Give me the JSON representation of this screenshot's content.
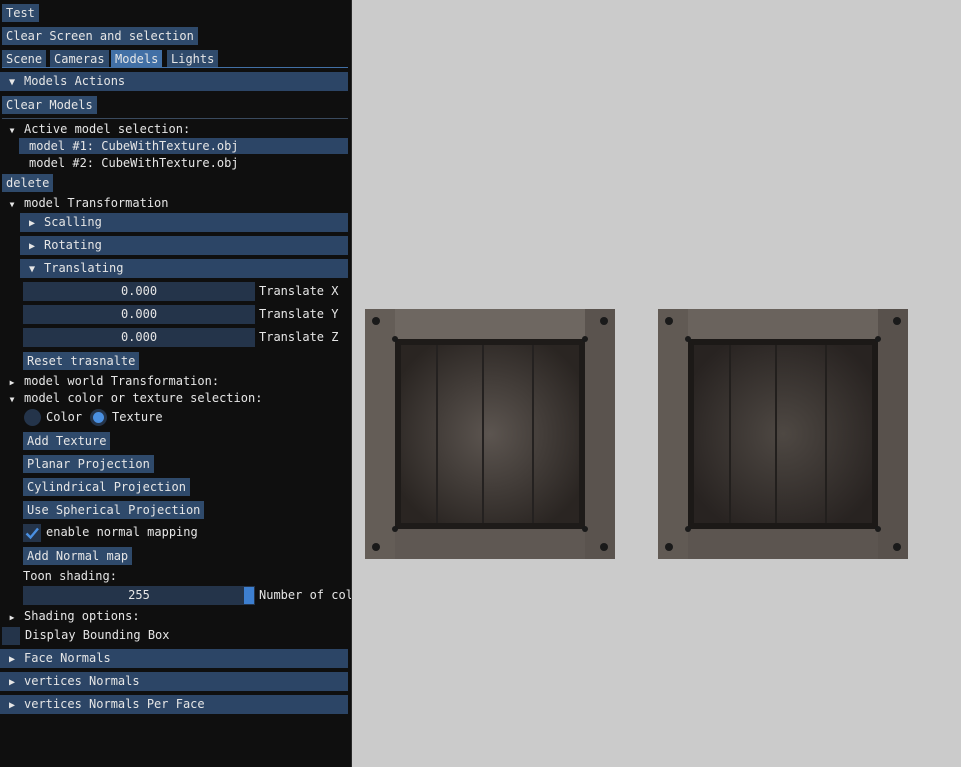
{
  "panel": {
    "test_label": "Test",
    "clear_screen_label": "Clear Screen and selection",
    "tabs": [
      {
        "label": "Scene"
      },
      {
        "label": "Cameras"
      },
      {
        "label": "Models"
      },
      {
        "label": "Lights"
      }
    ],
    "models_actions": "Models Actions",
    "clear_models": "Clear Models",
    "active_selection": "Active model selection:",
    "models": [
      "model #1: CubeWithTexture.obj",
      "model #2: CubeWithTexture.obj"
    ],
    "delete_label": "delete",
    "model_transformation": "model Transformation",
    "scalling": "Scalling",
    "rotating": "Rotating",
    "translating": "Translating",
    "translate": [
      {
        "value": "0.000",
        "label": "Translate X"
      },
      {
        "value": "0.000",
        "label": "Translate Y"
      },
      {
        "value": "0.000",
        "label": "Translate Z"
      }
    ],
    "reset_translate": "Reset trasnalte",
    "world_transformation": "model world Transformation:",
    "color_texture_selection": "model color or texture selection:",
    "color_label": "Color",
    "texture_label": "Texture",
    "selected_mode": "Texture",
    "add_texture": "Add Texture",
    "planar_projection": "Planar Projection",
    "cylindrical_projection": "Cylindrical Projection",
    "spherical_projection": "Use Spherical Projection",
    "normal_mapping_label": "enable normal mapping",
    "normal_mapping_checked": true,
    "add_normal_map": "Add Normal map",
    "toon_shading": "Toon shading:",
    "toon_value": "255",
    "toon_fill": 1.0,
    "num_colors_label": "Number of col",
    "shading_options": "Shading options:",
    "bounding_box_label": "Display Bounding Box",
    "bounding_box_checked": false,
    "face_normals": "Face Normals",
    "vertices_normals": "vertices Normals",
    "vertices_normals_per_face": "vertices Normals Per Face"
  },
  "icons": {
    "expanded": "triangle-down-icon",
    "collapsed": "triangle-right-icon",
    "check": "checkmark-icon"
  },
  "colors": {
    "button": "#2f4a6b",
    "active": "#4270a6",
    "accent": "#4a90e2",
    "panel_bg": "#0f0f0f",
    "viewport_bg": "#cbcbcb"
  }
}
